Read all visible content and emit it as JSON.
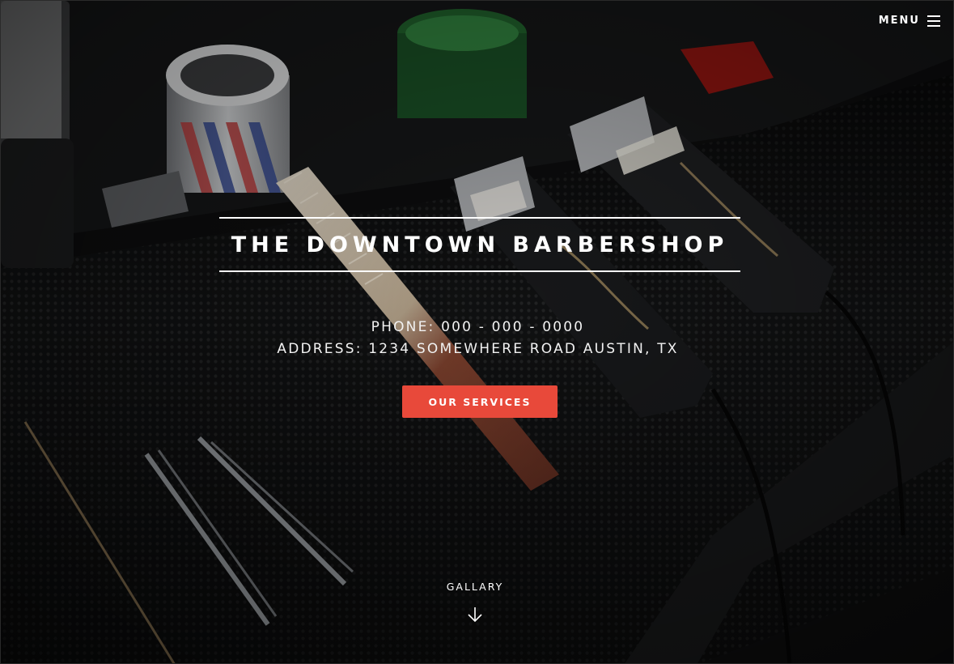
{
  "header": {
    "menu_label": "MENU",
    "menu_icon": "hamburger-icon"
  },
  "hero": {
    "title": "THE DOWNTOWN BARBERSHOP",
    "phone": "PHONE: 000 - 000 - 0000",
    "address": "ADDRESS: 1234 SOMEWHERE ROAD AUSTIN, TX",
    "cta_label": "OUR SERVICES",
    "scroll_label": "GALLARY",
    "scroll_icon": "arrow-down-icon",
    "background": "dark photo of barber tools: clippers, comb, hair pins, jars on a rubber mat"
  },
  "colors": {
    "accent": "#e8493a",
    "text": "#ffffff",
    "background": "#0b0b0c"
  }
}
